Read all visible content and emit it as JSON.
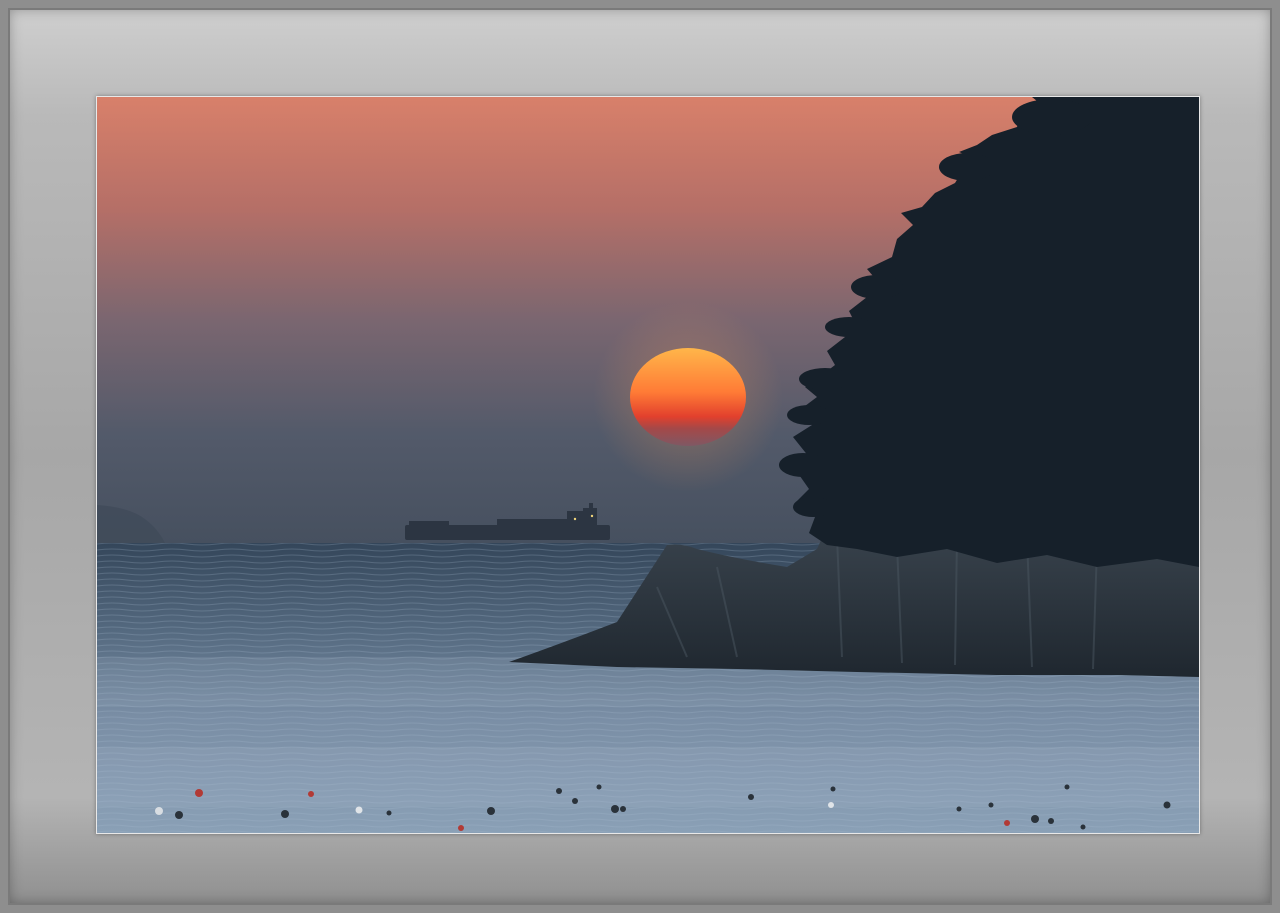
{
  "image": {
    "subject": "sunset-over-sea",
    "colors": {
      "sky_top": "#d47a64",
      "sky_mid": "#a86a66",
      "sky_haze": "#5f6072",
      "sky_bottom": "#4a5262",
      "sun_top": "#ffb048",
      "sun_bottom": "#d8332a",
      "sea_far": "#3b4b5e",
      "sea_near": "#7f95ac",
      "silhouette": "#151d26",
      "rock": "#2a333c",
      "frame": "#a9a9a9"
    }
  }
}
